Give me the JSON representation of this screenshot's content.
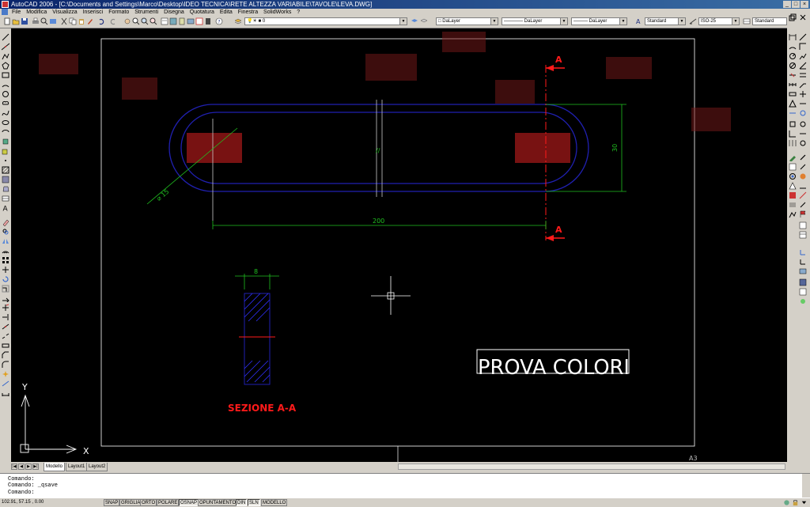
{
  "window": {
    "title": "AutoCAD 2006 - [C:\\Documents and Settings\\Marco\\Desktop\\IDEO TECNICA\\RETE ALTEZZA VARIABILE\\TAVOLE\\LEVA.DWG]",
    "controls": [
      "_",
      "□",
      "×"
    ]
  },
  "menu": {
    "items": [
      "File",
      "Modifica",
      "Visualizza",
      "Inserisci",
      "Formato",
      "Strumenti",
      "Disegna",
      "Quotatura",
      "Edita",
      "Finestra",
      "SolidWorks",
      "?"
    ]
  },
  "toolbar": {
    "layer_value": "0",
    "color_value": "DaLayer",
    "linetype_value": "DaLayer",
    "lineweight_value": "DaLayer",
    "text_style": "Standard",
    "dim_style": "ISO-25",
    "table_style": "Standard"
  },
  "drawing": {
    "diameter_label": "⌀ 15",
    "length_label": "200",
    "height_label": "30",
    "section_width_label": "8",
    "section_mark_top": "A",
    "section_mark_bottom": "A",
    "section_title": "SEZIONE A-A",
    "boxed_text": "PROVA COLORI",
    "sheet_label": "A3",
    "ucs_x": "X",
    "ucs_y": "Y",
    "colors": {
      "outline": "#2020b0",
      "dimension": "#20c020",
      "section": "#ff1a1a",
      "center": "#d0d0d0",
      "text": "#ffffff",
      "hatch": "#3030ff"
    }
  },
  "tabs": {
    "nav": [
      "|◀",
      "◀",
      "▶",
      "▶|"
    ],
    "items": [
      "Modello",
      "Layout1",
      "Layout2"
    ],
    "active": "Modello"
  },
  "command": {
    "lines": [
      "Comando:",
      "Comando: _qsave",
      "Comando:"
    ]
  },
  "status": {
    "coords": "102.91, 57.15 , 0.00",
    "toggles": [
      "SNAP",
      "GRIGLIA",
      "ORTO",
      "POLARE",
      "OSNAP",
      "OPUNTAMENTO",
      "DIN",
      "SLN",
      "MODELLO"
    ],
    "active_toggles": [
      "OSNAP",
      "DIN",
      "SLN"
    ]
  }
}
